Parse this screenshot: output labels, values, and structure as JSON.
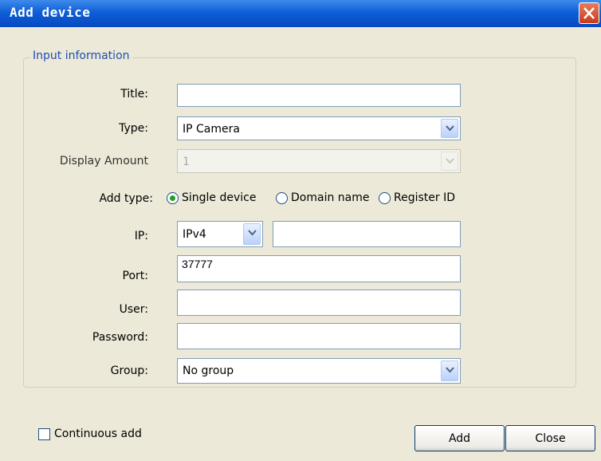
{
  "window": {
    "title": "Add device"
  },
  "group": {
    "legend": "Input information"
  },
  "form": {
    "title_label": "Title:",
    "title_value": "",
    "type_label": "Type:",
    "type_value": "IP Camera",
    "display_amount_label": "Display Amount",
    "display_amount_value": "1",
    "add_type_label": "Add type:",
    "add_type_options": [
      "Single device",
      "Domain name",
      "Register ID"
    ],
    "add_type_selected": "Single device",
    "ip_label": "IP:",
    "ip_version": "IPv4",
    "ip_value": "",
    "port_label": "Port:",
    "port_value": "37777",
    "user_label": "User:",
    "user_value": "",
    "password_label": "Password:",
    "password_value": "",
    "group_label": "Group:",
    "group_value": "No group"
  },
  "footer": {
    "continuous_add_label": "Continuous add",
    "continuous_add_checked": false,
    "add_button": "Add",
    "close_button": "Close"
  }
}
